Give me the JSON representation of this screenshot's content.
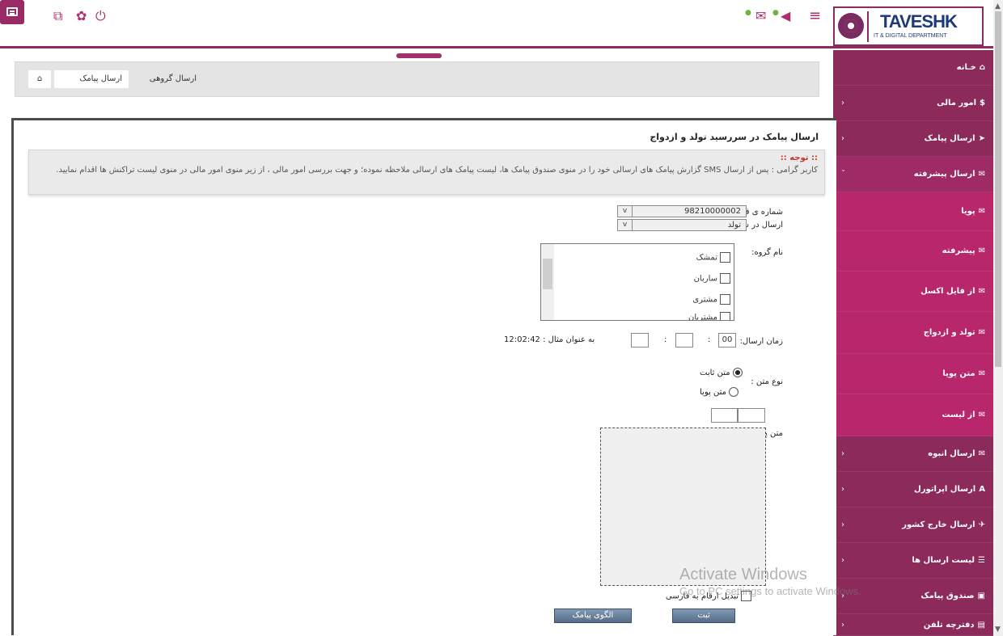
{
  "topbar": {
    "icons": [
      "menu-icon",
      "window-icon",
      "gear-icon",
      "power-icon",
      "mail-icon",
      "bell-icon",
      "hamburger-icon"
    ],
    "brand": {
      "name": "TAVESHK",
      "sub": "IT & DIGITAL DEPARTMENT"
    }
  },
  "breadcrumb": {
    "home_icon": "home-icon",
    "items": [
      "ارسال پیامک",
      "ارسال گروهی"
    ]
  },
  "sidebar": {
    "items": [
      {
        "label": "خـانه",
        "icon": "home-icon",
        "chev": ""
      },
      {
        "label": "امور مالی",
        "icon": "dollar-icon",
        "chev": "‹"
      },
      {
        "label": "ارسال پیامک",
        "icon": "send-icon",
        "chev": "‹"
      },
      {
        "label": "ارسال پیشرفته",
        "icon": "envelope-icon",
        "chev": "ˇ"
      },
      {
        "label": "پویا",
        "icon": "envelope-icon",
        "chev": ""
      },
      {
        "label": "پیشرفته",
        "icon": "envelope-icon",
        "chev": ""
      },
      {
        "label": "از فایل اکسل",
        "icon": "envelope-icon",
        "chev": ""
      },
      {
        "label": "تولد و ازدواج",
        "icon": "envelope-icon",
        "chev": ""
      },
      {
        "label": "متن پویا",
        "icon": "envelope-icon",
        "chev": ""
      },
      {
        "label": "از لیست",
        "icon": "envelope-icon",
        "chev": ""
      },
      {
        "label": "ارسال انبوه",
        "icon": "envelope-outline-icon",
        "chev": "‹"
      },
      {
        "label": "ارسال اپراتورل",
        "icon": "font-icon",
        "chev": "‹"
      },
      {
        "label": "ارسال خارج کشور",
        "icon": "plane-icon",
        "chev": "‹"
      },
      {
        "label": "لیست ارسال ها",
        "icon": "list-icon",
        "chev": "‹"
      },
      {
        "label": "صندوق پیامک",
        "icon": "inbox-icon",
        "chev": "‹"
      },
      {
        "label": "دفترچه تلفن",
        "icon": "book-icon",
        "chev": "‹"
      }
    ]
  },
  "panel": {
    "title": "ارسال پیامک در سررسید تولد و ازدواج",
    "notice_head": ":: توجه ::",
    "notice_body": "کاربر گرامی : پس از ارسال SMS گزارش پیامک های ارسالی خود را در منوی صندوق پیامک ها، لیست پیامک های ارسالی ملاحظه نموده؛ و جهت بررسی امور مالی ، از زیر منوی امور مالی در منوی لیست تراکنش ها اقدام نمایید."
  },
  "form": {
    "sender_label": "شماره ی فرستنده:",
    "sender_value": "98210000002",
    "due_label": "ارسال در سررسید :",
    "due_value": "تولد",
    "group_label": "نام گروه:",
    "groups": [
      "تمشک",
      "ساربان",
      "مشتری",
      "مشتریان"
    ],
    "time_label": "زمان ارسال:",
    "time_hour": "00",
    "time_example": "به عنوان مثال : 12:02:42",
    "text_type_label": "نوع متن :",
    "text_fixed": "متن ثابت",
    "text_dynamic": "متن پویا",
    "message_label": "متن پیامک:",
    "convert_digits": "تبدیل ارقام به فارسی",
    "submit_btn": "ثبت",
    "pattern_btn": "الگوی پیامک"
  },
  "watermark": {
    "line1": "Activate Windows",
    "line2": "Go to PC settings to activate Windows."
  },
  "colors": {
    "brand": "#8c2a5c",
    "submenu": "#b8276c",
    "accent": "#a2306b"
  }
}
